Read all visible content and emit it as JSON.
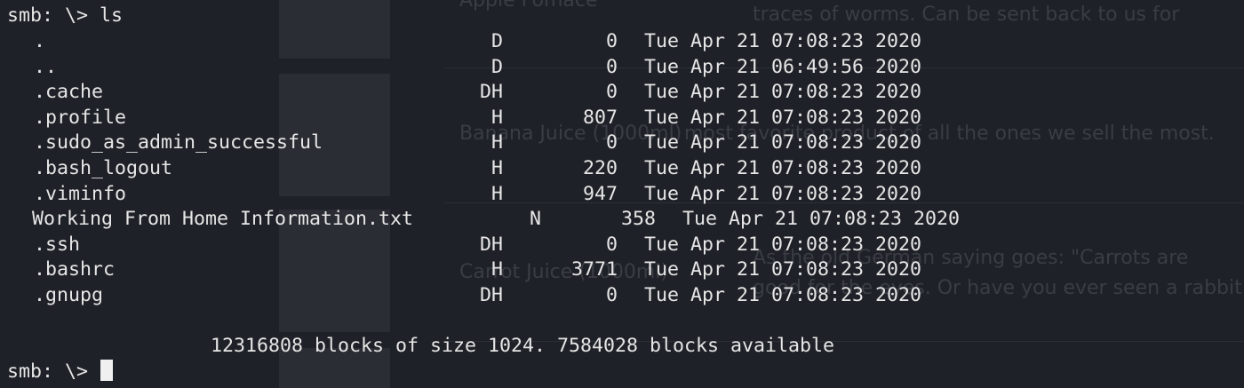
{
  "background_page": {
    "texts": [
      "Apple Fomace",
      "traces of worms. Can be sent back to us for",
      "Banana Juice (1000ml)",
      "  most favorite product of all the ones we sell the most.",
      "Carrot Juice (1000ml)",
      "As the old German saying goes: \"Carrots are",
      "  good for the eyes. Or have you ever seen a rabbit with glasses?\""
    ]
  },
  "terminal": {
    "prompt": "smb: \\>",
    "command": "ls",
    "entries": [
      {
        "name": ".",
        "attr": "D",
        "size": "0",
        "date": "Tue Apr 21 07:08:23 2020"
      },
      {
        "name": "..",
        "attr": "D",
        "size": "0",
        "date": "Tue Apr 21 06:49:56 2020"
      },
      {
        "name": ".cache",
        "attr": "DH",
        "size": "0",
        "date": "Tue Apr 21 07:08:23 2020"
      },
      {
        "name": ".profile",
        "attr": "H",
        "size": "807",
        "date": "Tue Apr 21 07:08:23 2020"
      },
      {
        "name": ".sudo_as_admin_successful",
        "attr": "H",
        "size": "0",
        "date": "Tue Apr 21 07:08:23 2020"
      },
      {
        "name": ".bash_logout",
        "attr": "H",
        "size": "220",
        "date": "Tue Apr 21 07:08:23 2020"
      },
      {
        "name": ".viminfo",
        "attr": "H",
        "size": "947",
        "date": "Tue Apr 21 07:08:23 2020"
      },
      {
        "name": "Working From Home Information.txt",
        "attr": "N",
        "size": "358",
        "date": "Tue Apr 21 07:08:23 2020"
      },
      {
        "name": ".ssh",
        "attr": "DH",
        "size": "0",
        "date": "Tue Apr 21 07:08:23 2020"
      },
      {
        "name": ".bashrc",
        "attr": "H",
        "size": "3771",
        "date": "Tue Apr 21 07:08:23 2020"
      },
      {
        "name": ".gnupg",
        "attr": "DH",
        "size": "0",
        "date": "Tue Apr 21 07:08:23 2020"
      }
    ],
    "summary": "12316808 blocks of size 1024. 7584028 blocks available"
  }
}
